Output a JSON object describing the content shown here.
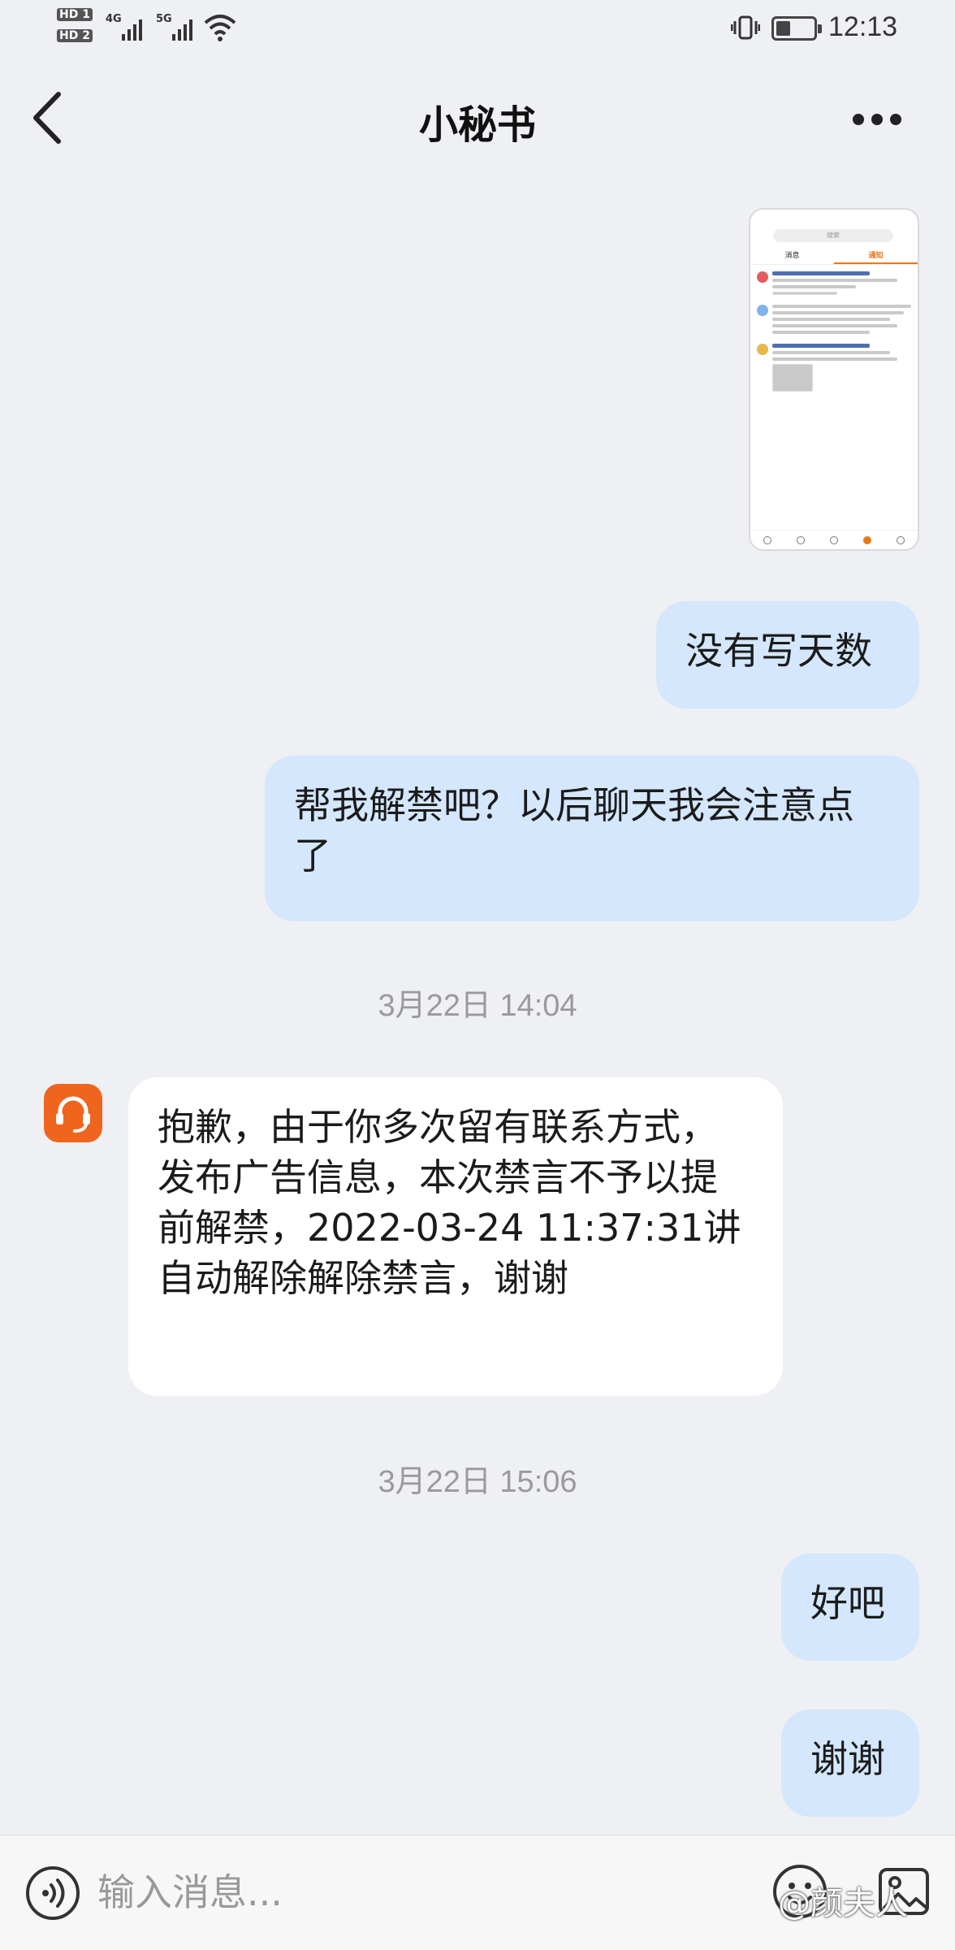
{
  "status_bar": {
    "sim1": "HD 1",
    "sim2": "HD 2",
    "net1": "4G",
    "net2": "5G",
    "time": "12:13"
  },
  "header": {
    "title": "小秘书"
  },
  "thumbnail": {
    "search": "搜索",
    "tab_messages": "消息",
    "tab_notifications": "通知"
  },
  "messages": [
    {
      "side": "me",
      "text": "没有写天数"
    },
    {
      "side": "me",
      "text": "帮我解禁吧？以后聊天我会注意点了"
    },
    {
      "side": "time",
      "text": "3月22日 14:04"
    },
    {
      "side": "them",
      "text": "抱歉，由于你多次留有联系方式，发布广告信息，本次禁言不予以提前解禁，2022-03-24 11:37:31讲自动解除解除禁言，谢谢"
    },
    {
      "side": "time",
      "text": "3月22日 15:06"
    },
    {
      "side": "me",
      "text": "好吧"
    },
    {
      "side": "me",
      "text": "谢谢"
    }
  ],
  "input": {
    "placeholder": "输入消息..."
  },
  "watermark": "@颜夫人",
  "colors": {
    "outgoing_bubble": "#d4e7fc",
    "incoming_bubble": "#ffffff",
    "agent_avatar": "#f0651e",
    "background": "#eef0f3"
  },
  "icons": [
    "back-arrow-icon",
    "more-icon",
    "headset-icon",
    "voice-icon",
    "emoji-icon",
    "image-icon",
    "wifi-icon",
    "battery-icon",
    "vibrate-icon",
    "signal-icon"
  ]
}
